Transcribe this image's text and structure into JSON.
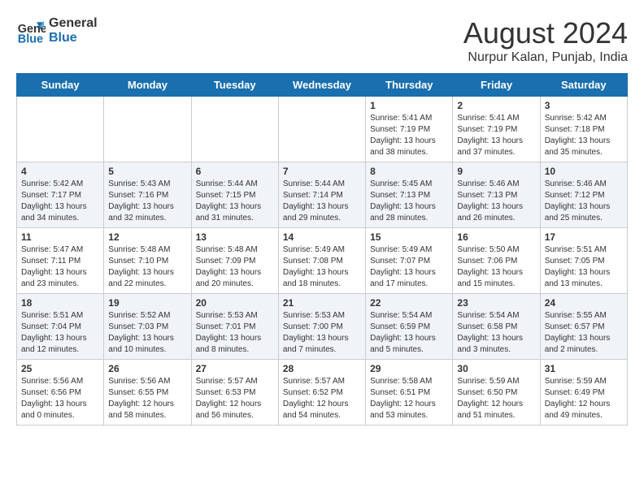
{
  "logo": {
    "line1": "General",
    "line2": "Blue"
  },
  "title": "August 2024",
  "location": "Nurpur Kalan, Punjab, India",
  "days_of_week": [
    "Sunday",
    "Monday",
    "Tuesday",
    "Wednesday",
    "Thursday",
    "Friday",
    "Saturday"
  ],
  "weeks": [
    [
      {
        "day": "",
        "info": ""
      },
      {
        "day": "",
        "info": ""
      },
      {
        "day": "",
        "info": ""
      },
      {
        "day": "",
        "info": ""
      },
      {
        "day": "1",
        "info": "Sunrise: 5:41 AM\nSunset: 7:19 PM\nDaylight: 13 hours\nand 38 minutes."
      },
      {
        "day": "2",
        "info": "Sunrise: 5:41 AM\nSunset: 7:19 PM\nDaylight: 13 hours\nand 37 minutes."
      },
      {
        "day": "3",
        "info": "Sunrise: 5:42 AM\nSunset: 7:18 PM\nDaylight: 13 hours\nand 35 minutes."
      }
    ],
    [
      {
        "day": "4",
        "info": "Sunrise: 5:42 AM\nSunset: 7:17 PM\nDaylight: 13 hours\nand 34 minutes."
      },
      {
        "day": "5",
        "info": "Sunrise: 5:43 AM\nSunset: 7:16 PM\nDaylight: 13 hours\nand 32 minutes."
      },
      {
        "day": "6",
        "info": "Sunrise: 5:44 AM\nSunset: 7:15 PM\nDaylight: 13 hours\nand 31 minutes."
      },
      {
        "day": "7",
        "info": "Sunrise: 5:44 AM\nSunset: 7:14 PM\nDaylight: 13 hours\nand 29 minutes."
      },
      {
        "day": "8",
        "info": "Sunrise: 5:45 AM\nSunset: 7:13 PM\nDaylight: 13 hours\nand 28 minutes."
      },
      {
        "day": "9",
        "info": "Sunrise: 5:46 AM\nSunset: 7:13 PM\nDaylight: 13 hours\nand 26 minutes."
      },
      {
        "day": "10",
        "info": "Sunrise: 5:46 AM\nSunset: 7:12 PM\nDaylight: 13 hours\nand 25 minutes."
      }
    ],
    [
      {
        "day": "11",
        "info": "Sunrise: 5:47 AM\nSunset: 7:11 PM\nDaylight: 13 hours\nand 23 minutes."
      },
      {
        "day": "12",
        "info": "Sunrise: 5:48 AM\nSunset: 7:10 PM\nDaylight: 13 hours\nand 22 minutes."
      },
      {
        "day": "13",
        "info": "Sunrise: 5:48 AM\nSunset: 7:09 PM\nDaylight: 13 hours\nand 20 minutes."
      },
      {
        "day": "14",
        "info": "Sunrise: 5:49 AM\nSunset: 7:08 PM\nDaylight: 13 hours\nand 18 minutes."
      },
      {
        "day": "15",
        "info": "Sunrise: 5:49 AM\nSunset: 7:07 PM\nDaylight: 13 hours\nand 17 minutes."
      },
      {
        "day": "16",
        "info": "Sunrise: 5:50 AM\nSunset: 7:06 PM\nDaylight: 13 hours\nand 15 minutes."
      },
      {
        "day": "17",
        "info": "Sunrise: 5:51 AM\nSunset: 7:05 PM\nDaylight: 13 hours\nand 13 minutes."
      }
    ],
    [
      {
        "day": "18",
        "info": "Sunrise: 5:51 AM\nSunset: 7:04 PM\nDaylight: 13 hours\nand 12 minutes."
      },
      {
        "day": "19",
        "info": "Sunrise: 5:52 AM\nSunset: 7:03 PM\nDaylight: 13 hours\nand 10 minutes."
      },
      {
        "day": "20",
        "info": "Sunrise: 5:53 AM\nSunset: 7:01 PM\nDaylight: 13 hours\nand 8 minutes."
      },
      {
        "day": "21",
        "info": "Sunrise: 5:53 AM\nSunset: 7:00 PM\nDaylight: 13 hours\nand 7 minutes."
      },
      {
        "day": "22",
        "info": "Sunrise: 5:54 AM\nSunset: 6:59 PM\nDaylight: 13 hours\nand 5 minutes."
      },
      {
        "day": "23",
        "info": "Sunrise: 5:54 AM\nSunset: 6:58 PM\nDaylight: 13 hours\nand 3 minutes."
      },
      {
        "day": "24",
        "info": "Sunrise: 5:55 AM\nSunset: 6:57 PM\nDaylight: 13 hours\nand 2 minutes."
      }
    ],
    [
      {
        "day": "25",
        "info": "Sunrise: 5:56 AM\nSunset: 6:56 PM\nDaylight: 13 hours\nand 0 minutes."
      },
      {
        "day": "26",
        "info": "Sunrise: 5:56 AM\nSunset: 6:55 PM\nDaylight: 12 hours\nand 58 minutes."
      },
      {
        "day": "27",
        "info": "Sunrise: 5:57 AM\nSunset: 6:53 PM\nDaylight: 12 hours\nand 56 minutes."
      },
      {
        "day": "28",
        "info": "Sunrise: 5:57 AM\nSunset: 6:52 PM\nDaylight: 12 hours\nand 54 minutes."
      },
      {
        "day": "29",
        "info": "Sunrise: 5:58 AM\nSunset: 6:51 PM\nDaylight: 12 hours\nand 53 minutes."
      },
      {
        "day": "30",
        "info": "Sunrise: 5:59 AM\nSunset: 6:50 PM\nDaylight: 12 hours\nand 51 minutes."
      },
      {
        "day": "31",
        "info": "Sunrise: 5:59 AM\nSunset: 6:49 PM\nDaylight: 12 hours\nand 49 minutes."
      }
    ]
  ]
}
